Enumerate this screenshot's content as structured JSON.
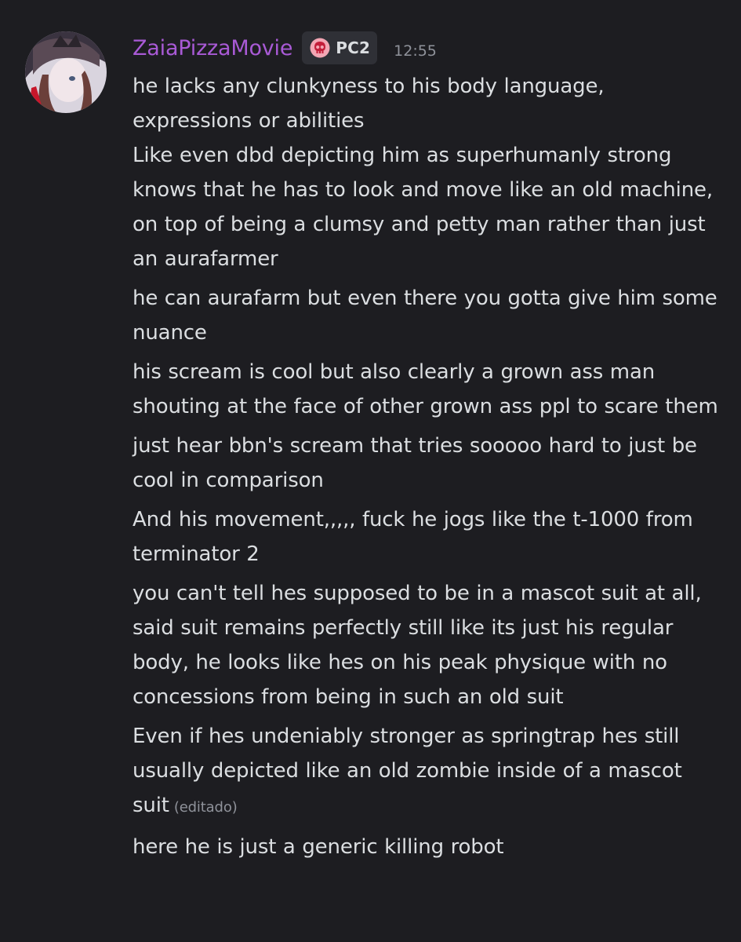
{
  "message": {
    "username": "ZaiaPizzaMovie",
    "tag": {
      "icon": "skull-icon",
      "label": "PC2"
    },
    "timestamp": "12:55",
    "username_color": "#a95ad6",
    "lines": [
      "he lacks any clunkyness to his body language, expressions or abilities\nLike even dbd depicting him as superhumanly strong knows that he has to look and move like an old machine, on top of being a clumsy and petty man rather than just an aurafarmer",
      "he can aurafarm but even there you gotta give him some nuance",
      "his scream is cool but also clearly a grown ass man shouting at the face of other grown ass ppl to scare them",
      "just hear bbn's scream that tries sooooo hard to just be cool in comparison",
      "And his movement,,,,, fuck he jogs like the t-1000 from terminator 2",
      "you can't tell hes supposed to be in a mascot suit at all, said suit remains perfectly still like its just his regular body, he looks like hes on his peak physique with no concessions from being in such an old suit",
      "Even if hes undeniably stronger as springtrap hes still usually depicted like an old zombie inside of a mascot suit",
      "here he is just a generic killing robot"
    ],
    "edited_label": "(editado)"
  }
}
